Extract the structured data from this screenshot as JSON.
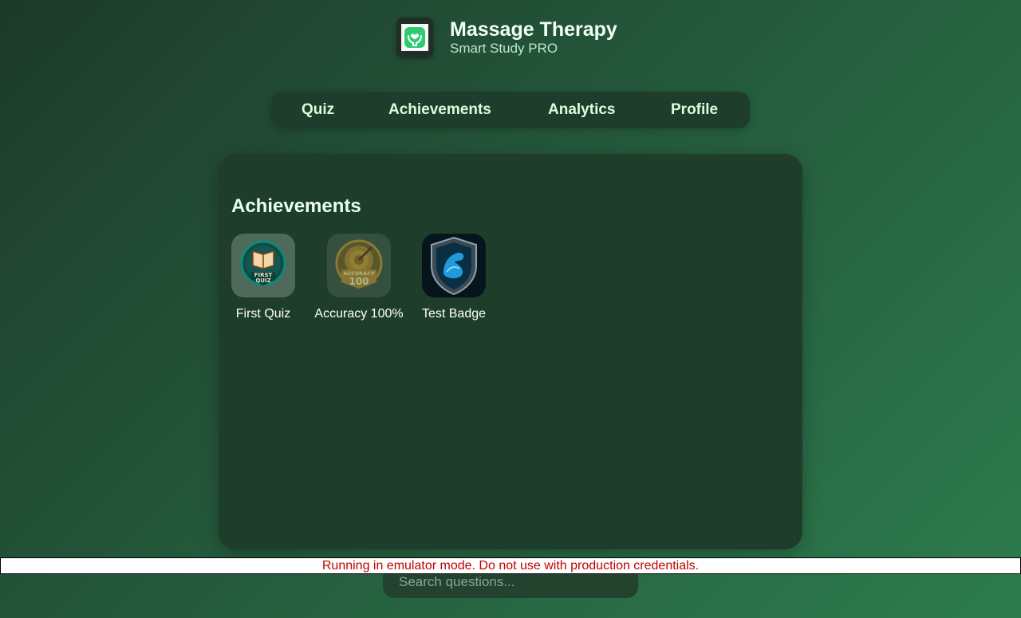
{
  "header": {
    "title": "Massage Therapy",
    "subtitle": "Smart Study PRO",
    "icon": "hands-heart-icon"
  },
  "nav": {
    "tabs": [
      {
        "label": "Quiz"
      },
      {
        "label": "Achievements"
      },
      {
        "label": "Analytics"
      },
      {
        "label": "Profile"
      }
    ]
  },
  "achievements": {
    "title": "Achievements",
    "badges": [
      {
        "label": "First Quiz",
        "icon": "open-book-badge-icon",
        "icon_text": [
          "FIRST",
          "QUIZ"
        ]
      },
      {
        "label": "Accuracy 100%",
        "icon": "target-badge-icon",
        "icon_text": [
          "ACCURACY",
          "100"
        ]
      },
      {
        "label": "Test Badge",
        "icon": "shield-muscle-badge-icon"
      }
    ]
  },
  "search": {
    "placeholder": "Search questions..."
  },
  "banner": {
    "text": "Running in emulator mode. Do not use with production credentials."
  },
  "colors": {
    "accent": "#2ecc71",
    "nav_text": "#d8ffd9",
    "banner_text": "#c00000"
  }
}
